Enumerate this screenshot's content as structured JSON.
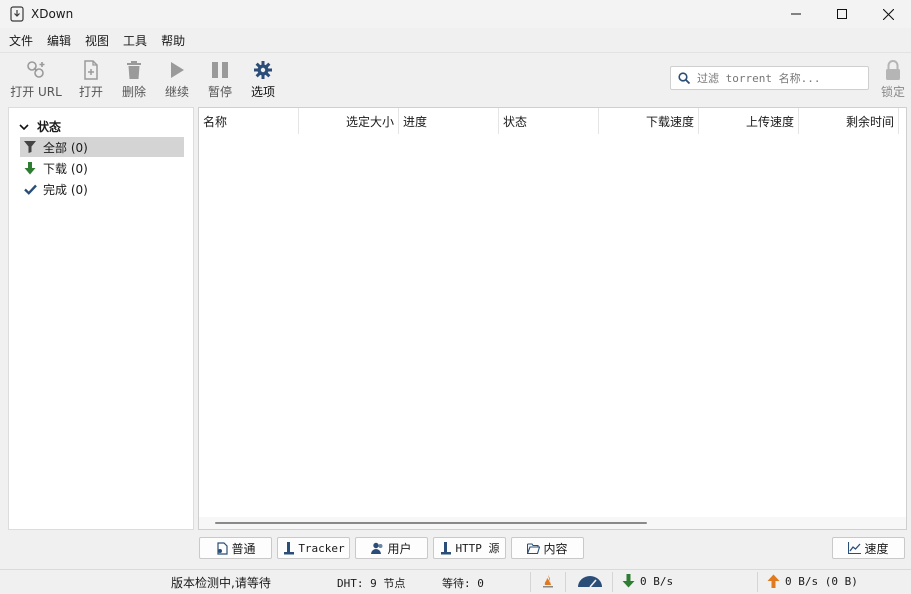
{
  "window": {
    "title": "XDown",
    "minimize_icon": "minimize-icon",
    "maximize_icon": "maximize-icon",
    "close_icon": "close-icon"
  },
  "menu": [
    "文件",
    "编辑",
    "视图",
    "工具",
    "帮助"
  ],
  "toolbar": {
    "open_url": "打开 URL",
    "open": "打开",
    "delete": "删除",
    "resume": "继续",
    "pause": "暂停",
    "options": "选项",
    "lock": "锁定",
    "search_placeholder": "过滤 torrent 名称..."
  },
  "sidebar": {
    "header": "状态",
    "items": [
      {
        "label": "全部 (0)",
        "icon": "filter-icon",
        "selected": true
      },
      {
        "label": "下载 (0)",
        "icon": "download-arrow-icon",
        "selected": false
      },
      {
        "label": "完成 (0)",
        "icon": "checkmark-icon",
        "selected": false
      }
    ]
  },
  "columns": [
    "名称",
    "选定大小",
    "进度",
    "状态",
    "下载速度",
    "上传速度",
    "剩余时间"
  ],
  "tabs": {
    "general": "普通",
    "tracker": "Tracker",
    "peers": "用户",
    "http_source": "HTTP 源",
    "content": "内容",
    "speed": "速度"
  },
  "status": {
    "version_check": "版本检测中,请等待",
    "dht": "DHT: 9 节点",
    "waiting": "等待: 0",
    "download_rate": "0 B/s",
    "upload_rate": "0 B/s (0 B)"
  },
  "colors": {
    "accent_blue": "#2b5a8a",
    "download_green": "#2e7d32",
    "upload_orange": "#e07a1f",
    "selected_bg": "#d4d4d4"
  }
}
